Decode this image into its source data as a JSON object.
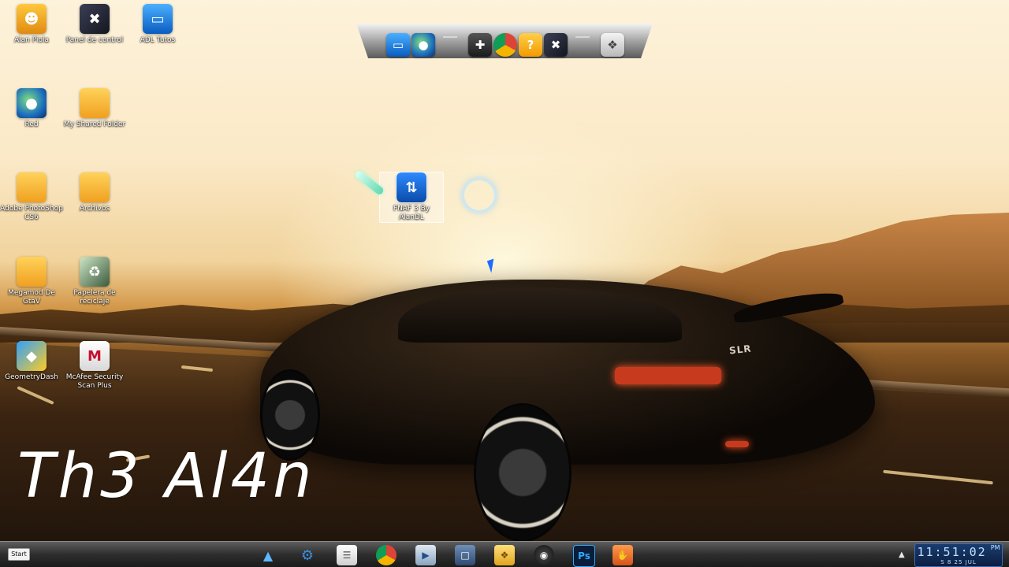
{
  "desktop": {
    "icons": [
      {
        "label": "Alan Piola",
        "icon": "user-icon"
      },
      {
        "label": "Panel de control",
        "icon": "control-panel-icon"
      },
      {
        "label": "ADL Tutos",
        "icon": "computer-icon"
      },
      {
        "label": "Red",
        "icon": "network-globe-icon"
      },
      {
        "label": "My Shared Folder",
        "icon": "folder-icon"
      },
      {
        "label": "Adobe PhotoShop CS6",
        "icon": "folder-icon"
      },
      {
        "label": "Archivos",
        "icon": "folder-icon"
      },
      {
        "label": "Megamod De GtaV",
        "icon": "folder-icon"
      },
      {
        "label": "Papelera de reciclaje",
        "icon": "recycle-bin-icon"
      },
      {
        "label": "GeometryDash",
        "icon": "geometry-dash-icon"
      },
      {
        "label": "McAfee Security Scan Plus",
        "icon": "mcafee-icon"
      },
      {
        "label": "FNAF 3 By AlanDL",
        "icon": "zip-archive-icon",
        "selected": true
      }
    ],
    "watermark": "Th3 Al4n"
  },
  "dock": {
    "items": [
      "computer-icon",
      "network-globe-icon",
      "games-icon",
      "chrome-icon",
      "help-icon",
      "control-panel-icon",
      "windows-flag-icon"
    ]
  },
  "taskbar": {
    "start_label": "Start",
    "apps": [
      "arch-launcher-icon",
      "gear-app-icon",
      "notepad-icon",
      "chrome-icon",
      "media-player-icon",
      "app-window-icon",
      "windows-explorer-icon",
      "steam-icon",
      "photoshop-icon",
      "hand-app-icon"
    ],
    "photoshop_label": "Ps",
    "clock": {
      "time": "11:51:02",
      "ampm": "PM",
      "date": "S 8 25 JUL"
    }
  }
}
